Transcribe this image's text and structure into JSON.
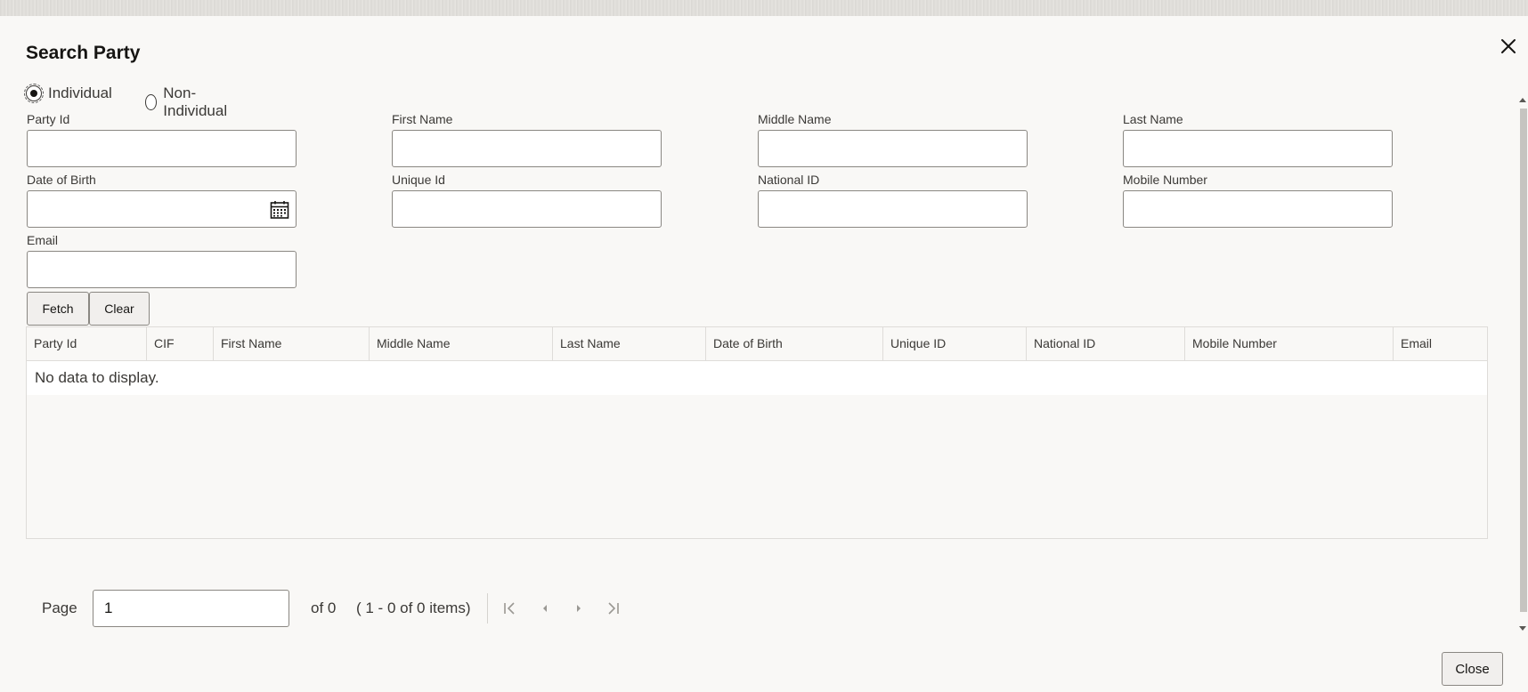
{
  "dialog": {
    "title": "Search Party"
  },
  "party_type": {
    "options": [
      {
        "label": "Individual",
        "selected": true
      },
      {
        "label": "Non-Individual",
        "selected": false
      }
    ]
  },
  "fields": {
    "party_id": {
      "label": "Party Id",
      "value": ""
    },
    "first_name": {
      "label": "First Name",
      "value": ""
    },
    "middle_name": {
      "label": "Middle Name",
      "value": ""
    },
    "last_name": {
      "label": "Last Name",
      "value": ""
    },
    "date_of_birth": {
      "label": "Date of Birth",
      "value": ""
    },
    "unique_id": {
      "label": "Unique Id",
      "value": ""
    },
    "national_id": {
      "label": "National ID",
      "value": ""
    },
    "mobile_number": {
      "label": "Mobile Number",
      "value": ""
    },
    "email": {
      "label": "Email",
      "value": ""
    }
  },
  "actions": {
    "fetch": "Fetch",
    "clear": "Clear",
    "close": "Close"
  },
  "table": {
    "columns": [
      "Party Id",
      "CIF",
      "First Name",
      "Middle Name",
      "Last Name",
      "Date of Birth",
      "Unique ID",
      "National ID",
      "Mobile Number",
      "Email"
    ],
    "rows": [],
    "empty_message": "No data to display."
  },
  "pagination": {
    "page_label": "Page",
    "page_value": "1",
    "of_pages": "of 0",
    "items_summary": "( 1 - 0 of 0 items)"
  },
  "icons": {
    "close": "close-icon",
    "calendar": "calendar-icon",
    "first_page": "first-page-icon",
    "prev_page": "previous-page-icon",
    "next_page": "next-page-icon",
    "last_page": "last-page-icon"
  }
}
